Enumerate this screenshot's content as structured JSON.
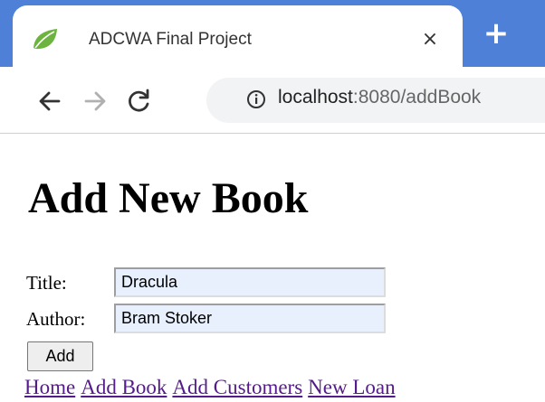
{
  "browser": {
    "tab_title": "ADCWA Final Project",
    "tab_close_glyph": "×",
    "new_tab_glyph": "+",
    "url_host": "localhost",
    "url_path": ":8080/addBook",
    "icons": {
      "favicon": "spring-leaf-icon",
      "back": "arrow-left-icon",
      "forward": "arrow-right-icon",
      "reload": "reload-icon",
      "info": "info-icon"
    },
    "colors": {
      "tabstrip": "#4d80d6",
      "favicon": "#6db33f"
    }
  },
  "page": {
    "heading": "Add New Book",
    "form": {
      "title_label": "Title:",
      "title_value": "Dracula",
      "author_label": "Author:",
      "author_value": "Bram Stoker",
      "submit_label": "Add",
      "autofill_bg": "#e8f0fe"
    },
    "nav_links": [
      {
        "label": "Home"
      },
      {
        "label": "Add Book"
      },
      {
        "label": "Add Customers"
      },
      {
        "label": "New Loan"
      }
    ],
    "link_color": "#551a8b"
  }
}
